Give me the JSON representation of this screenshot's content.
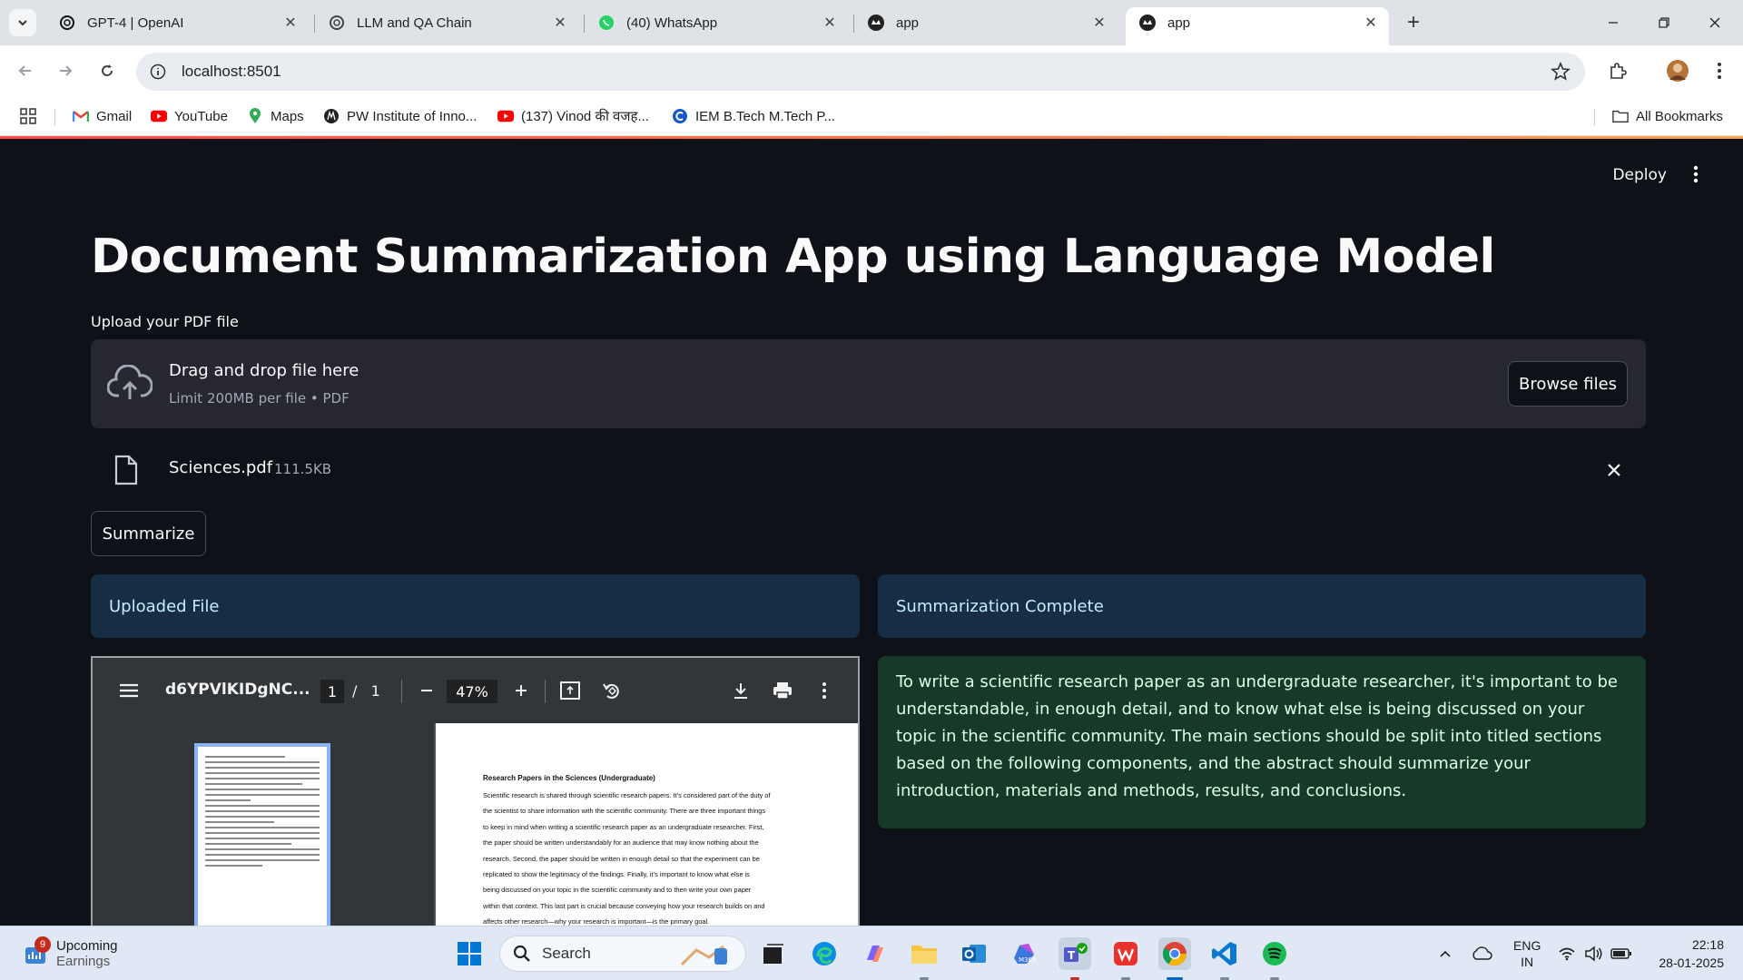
{
  "browser": {
    "tabs": [
      {
        "title": "GPT-4 | OpenAI",
        "icon": "openai-icon"
      },
      {
        "title": "LLM and QA Chain",
        "icon": "openai-icon"
      },
      {
        "title": "(40) WhatsApp",
        "icon": "whatsapp-icon"
      },
      {
        "title": "app",
        "icon": "streamlit-icon"
      },
      {
        "title": "app",
        "icon": "streamlit-icon",
        "active": true
      }
    ],
    "url": "localhost:8501",
    "bookmarks": [
      {
        "label": "Gmail",
        "icon": "gmail-icon"
      },
      {
        "label": "YouTube",
        "icon": "youtube-icon"
      },
      {
        "label": "Maps",
        "icon": "maps-icon"
      },
      {
        "label": "PW Institute of Inno...",
        "icon": "pw-icon"
      },
      {
        "label": "(137) Vinod की वजह...",
        "icon": "youtube-icon"
      },
      {
        "label": "IEM B.Tech M.Tech P...",
        "icon": "iem-icon"
      }
    ],
    "all_bookmarks": "All Bookmarks"
  },
  "app": {
    "deploy_label": "Deploy",
    "title": "Document Summarization App using Language Model",
    "upload_label": "Upload your PDF file",
    "dropzone": {
      "primary": "Drag and drop file here",
      "secondary": "Limit 200MB per file • PDF",
      "browse_label": "Browse files"
    },
    "uploaded_file": {
      "name": "Sciences.pdf",
      "size": "111.5KB"
    },
    "summarize_label": "Summarize",
    "uploaded_file_header": "Uploaded File",
    "summary_header": "Summarization Complete",
    "summary_text": "To write a scientific research paper as an undergraduate researcher, it's important to be understandable, in enough detail, and to know what else is being discussed on your topic in the scientific community. The main sections should be split into titled sections based on the following components, and the abstract should summarize your introduction, materials and methods, results, and conclusions.",
    "pdf_viewer": {
      "doc_name": "d6YPVlKIDgNC...",
      "current_page": "1",
      "page_sep": "/",
      "total_pages": "1",
      "zoom": "47%",
      "page_heading": "Research Papers in the Sciences (Undergraduate)",
      "page_lines": [
        "Scientific research is shared through scientific research papers. It’s considered part of the duty of",
        "the scientist to share information with the scientific community. There are three important things",
        "to keep in mind when writing a scientific research paper as an undergraduate researcher. First,",
        "the paper should be written understandably for an audience that may know nothing about the",
        "research. Second, the paper should be written in enough detail so that the experiment can be",
        "replicated to show the legitimacy of the findings. Finally, it’s important to know what else is",
        "being discussed on your topic in the scientific community and to then write your own paper",
        "within that context. This last part is crucial because conveying how your research builds on and",
        "affects other research—why your research is important—is the primary goal."
      ]
    }
  },
  "taskbar": {
    "weather_badge": "9",
    "weather_title": "Upcoming",
    "weather_sub": "Earnings",
    "search_placeholder": "Search",
    "lang_1": "ENG",
    "lang_2": "IN",
    "time": "22:18",
    "date": "28-01-2025"
  },
  "colors": {
    "app_bg": "#0e1117",
    "info_bg": "#172d43",
    "success_bg": "#173928",
    "accent": "#ff4b4b"
  }
}
